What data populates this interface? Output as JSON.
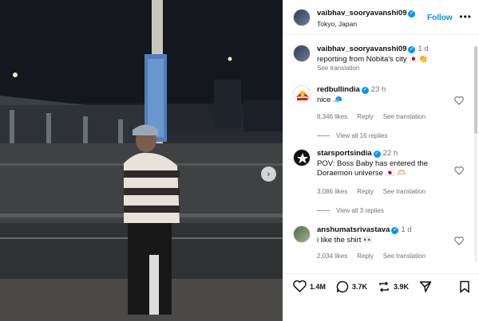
{
  "post": {
    "username": "vaibhav_sooryavanshi09",
    "location": "Tokyo, Japan",
    "follow_label": "Follow",
    "more_label": "•••"
  },
  "caption": {
    "username": "vaibhav_sooryavanshi09",
    "time": "1 d",
    "text": "reporting from Nobita's city 🇯🇵👏",
    "translation": "See translation"
  },
  "comments": [
    {
      "username": "redbullindia",
      "time": "23 h",
      "text": "nice 🧢",
      "likes": "8,346 likes",
      "reply": "Reply",
      "translation": "See translation",
      "replies": "View all 16 replies"
    },
    {
      "username": "starsportsindia",
      "time": "22 h",
      "text": "POV: Boss Baby has entered the Doraemon universe 🇯🇵 🫶🏻",
      "likes": "3,086 likes",
      "reply": "Reply",
      "translation": "See translation",
      "replies": "View all 3 replies"
    },
    {
      "username": "anshumatsrivastava",
      "time": "1 d",
      "text": "i like the shirt 👀",
      "likes": "2,034 likes",
      "reply": "Reply",
      "translation": "See translation"
    }
  ],
  "actions": {
    "like_count": "1.4M",
    "comment_count": "3.7K",
    "share_count": "3.9K"
  },
  "colors": {
    "accent": "#0095f6",
    "muted": "#737373"
  }
}
